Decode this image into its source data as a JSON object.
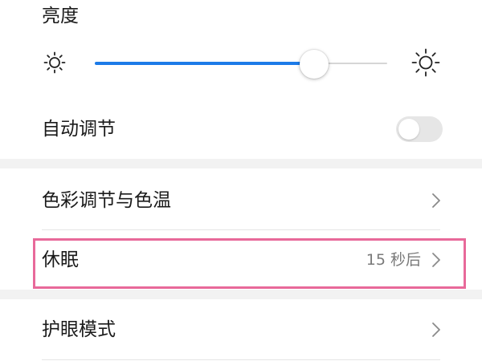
{
  "brightness": {
    "title": "亮度",
    "level_percent": 75,
    "low_icon": "sun-dim-icon",
    "high_icon": "sun-bright-icon"
  },
  "auto_adjust": {
    "label": "自动调节",
    "enabled": false
  },
  "menu": {
    "color_temp": {
      "label": "色彩调节与色温",
      "icon": "chevron-right-icon"
    },
    "sleep": {
      "label": "休眠",
      "value": "15 秒后",
      "icon": "chevron-right-icon"
    },
    "eye_comfort": {
      "label": "护眼模式",
      "icon": "chevron-right-icon"
    }
  },
  "colors": {
    "accent": "#1c7be8",
    "highlight": "#e8699a",
    "section_gap": "#f2f2f2"
  }
}
